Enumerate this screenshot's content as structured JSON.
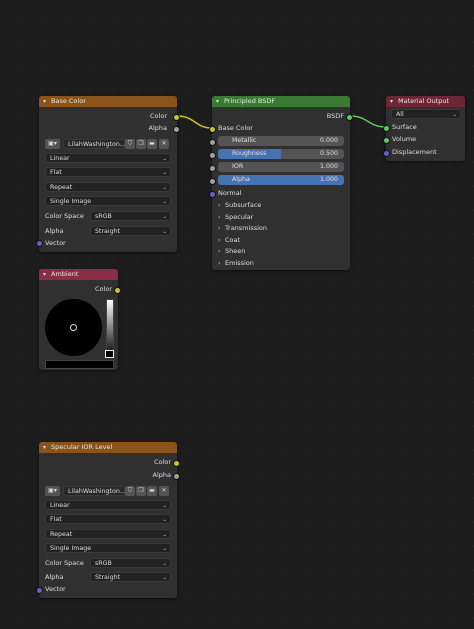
{
  "nodes": {
    "base_color": {
      "title": "Base Color",
      "outputs": [
        "Color",
        "Alpha"
      ],
      "image_name": "LilahWashington...",
      "dropdowns": [
        "Linear",
        "Flat",
        "Repeat",
        "Single Image"
      ],
      "color_space_label": "Color Space",
      "color_space_value": "sRGB",
      "alpha_label": "Alpha",
      "alpha_value": "Straight",
      "input_vector": "Vector"
    },
    "principled": {
      "title": "Principled BSDF",
      "output": "BSDF",
      "input_base_color": "Base Color",
      "sliders": [
        {
          "label": "Metallic",
          "value": "0.000",
          "fill": 0
        },
        {
          "label": "Roughness",
          "value": "0.500",
          "fill": 0.5
        },
        {
          "label": "IOR",
          "value": "1.000",
          "fill": 0
        },
        {
          "label": "Alpha",
          "value": "1.000",
          "fill": 1.0
        }
      ],
      "input_normal": "Normal",
      "panels": [
        "Subsurface",
        "Specular",
        "Transmission",
        "Coat",
        "Sheen",
        "Emission"
      ]
    },
    "material_output": {
      "title": "Material Output",
      "target": "All",
      "inputs": [
        "Surface",
        "Volume",
        "Displacement"
      ]
    },
    "ambient": {
      "title": "Ambient",
      "output": "Color"
    },
    "specular_ior": {
      "title": "Specular IOR Level",
      "outputs": [
        "Color",
        "Alpha"
      ],
      "image_name": "LilahWashington...",
      "dropdowns": [
        "Linear",
        "Flat",
        "Repeat",
        "Single Image"
      ],
      "color_space_label": "Color Space",
      "color_space_value": "sRGB",
      "alpha_label": "Alpha",
      "alpha_value": "Straight",
      "input_vector": "Vector"
    }
  },
  "colors": {
    "texture_header": "#8a5319",
    "bsdf_header": "#3a7b33",
    "output_header": "#6d2633",
    "ambient_header": "#8b2c48",
    "link_yellow": "#c7c729",
    "link_green": "#63c763"
  }
}
